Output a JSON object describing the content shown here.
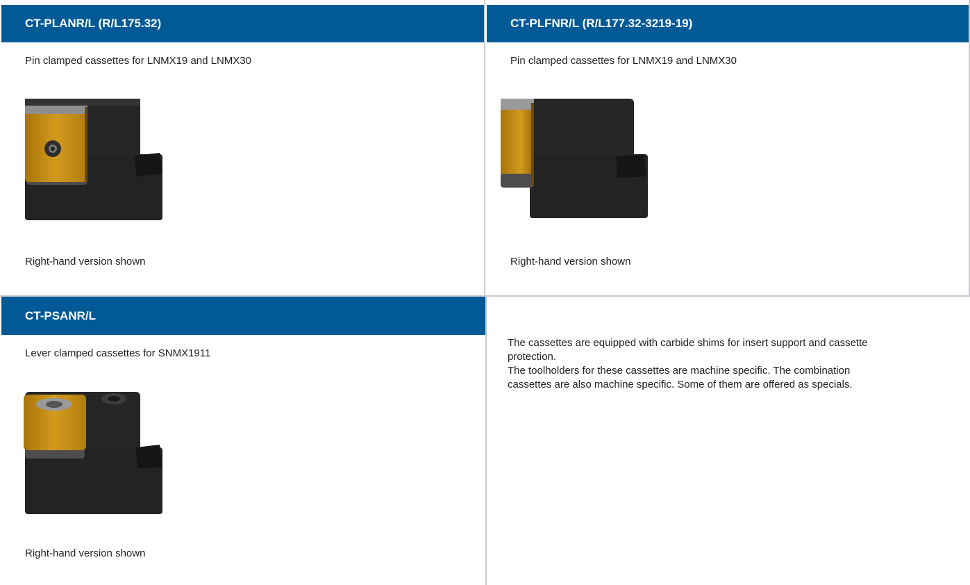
{
  "panels": [
    {
      "title": "CT-PLANR/L (R/L175.32)",
      "description": "Pin clamped cassettes for LNMX19 and LNMX30",
      "note": "Right-hand version shown"
    },
    {
      "title": "CT-PLFNR/L (R/L177.32-3219-19)",
      "description": "Pin clamped cassettes for LNMX19 and LNMX30",
      "note": "Right-hand version shown"
    },
    {
      "title": "CT-PSANR/L",
      "description": "Lever clamped cassettes for SNMX1911",
      "note": "Right-hand version shown"
    }
  ],
  "info": {
    "paragraph1": "The cassettes are equipped with carbide shims for insert support and cassette protection.",
    "paragraph2": "The toolholders for these cassettes are machine specific. The combination cassettes are also machine specific. Some of them are offered as specials."
  },
  "colors": {
    "header_bg": "#015a96",
    "header_text": "#ffffff",
    "insert_gold": "#c28a12",
    "body_black": "#1f1f1f",
    "border": "#c9cdd1"
  }
}
